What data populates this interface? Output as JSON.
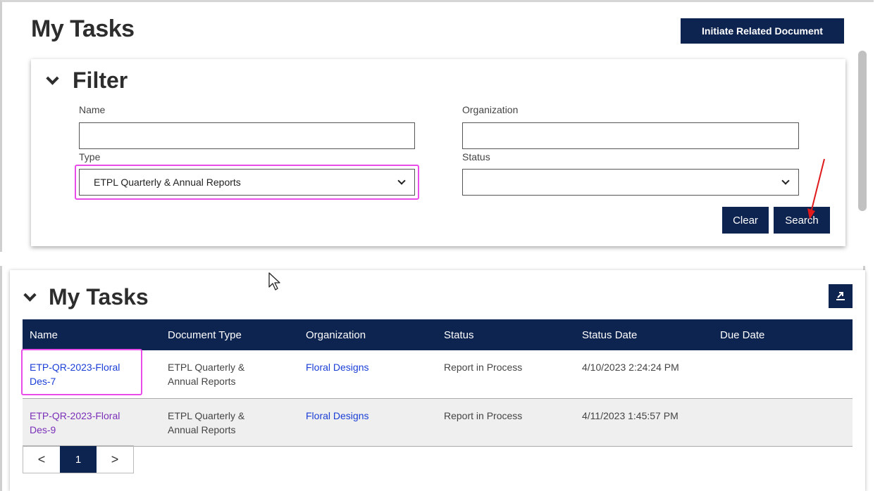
{
  "page": {
    "title": "My Tasks",
    "initiate_label": "Initiate Related Document"
  },
  "filter": {
    "title": "Filter",
    "name_label": "Name",
    "name_value": "",
    "organization_label": "Organization",
    "organization_value": "",
    "type_label": "Type",
    "type_selected": "ETPL Quarterly & Annual Reports",
    "status_label": "Status",
    "status_selected": "",
    "clear_label": "Clear",
    "search_label": "Search"
  },
  "tasks": {
    "title": "My Tasks",
    "columns": [
      "Name",
      "Document Type",
      "Organization",
      "Status",
      "Status Date",
      "Due Date"
    ],
    "rows": [
      {
        "name_line1": "ETP-QR-2023-Floral",
        "name_line2": "Des-7",
        "doc_type_line1": "ETPL Quarterly &",
        "doc_type_line2": "Annual Reports",
        "organization": "Floral Designs",
        "status": "Report in Process",
        "status_date": "4/10/2023 2:24:24 PM",
        "due_date": ""
      },
      {
        "name_line1": "ETP-QR-2023-Floral",
        "name_line2": "Des-9",
        "doc_type_line1": "ETPL Quarterly &",
        "doc_type_line2": "Annual Reports",
        "organization": "Floral Designs",
        "status": "Report in Process",
        "status_date": "4/11/2023 1:45:57 PM",
        "due_date": ""
      }
    ]
  },
  "pagination": {
    "prev": "<",
    "current": "1",
    "next": ">"
  },
  "colors": {
    "navy": "#0d2350",
    "highlight": "#e94ce8",
    "annotation_arrow": "#e0191b",
    "link": "#1a3ed6",
    "visited_link": "#7a2fb8"
  },
  "icons": [
    "chevron-down-icon",
    "select-caret-icon",
    "export-icon",
    "mouse-cursor-icon",
    "red-arrow-annotation"
  ]
}
